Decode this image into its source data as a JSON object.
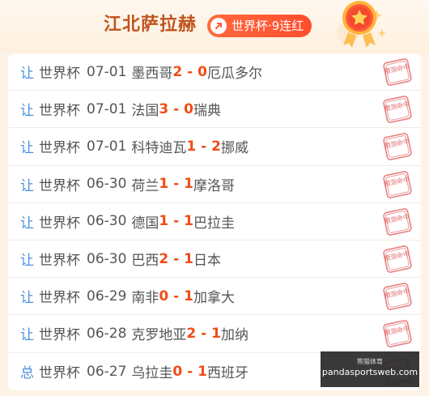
{
  "header": {
    "expert_name": "江北萨拉赫",
    "streak_label": "世界杯·9连红",
    "badge_color": "#ff5a35",
    "medal_icon": "star-medal-icon"
  },
  "stamp_text": "预测命中",
  "results": [
    {
      "type": "让",
      "league": "世界杯",
      "date": "07-01",
      "home": "墨西哥",
      "home_score": "2",
      "sep": " - ",
      "away_score": "0",
      "away": "厄瓜多尔"
    },
    {
      "type": "让",
      "league": "世界杯",
      "date": "07-01",
      "home": "法国",
      "home_score": "3",
      "sep": " - ",
      "away_score": "0",
      "away": "瑞典"
    },
    {
      "type": "让",
      "league": "世界杯",
      "date": "07-01",
      "home": "科特迪瓦",
      "home_score": "1",
      "sep": " - ",
      "away_score": "2",
      "away": "挪威"
    },
    {
      "type": "让",
      "league": "世界杯",
      "date": "06-30",
      "home": "荷兰",
      "home_score": "1",
      "sep": " - ",
      "away_score": "1",
      "away": "摩洛哥"
    },
    {
      "type": "让",
      "league": "世界杯",
      "date": "06-30",
      "home": "德国",
      "home_score": "1",
      "sep": " - ",
      "away_score": "1",
      "away": "巴拉圭"
    },
    {
      "type": "让",
      "league": "世界杯",
      "date": "06-30",
      "home": "巴西",
      "home_score": "2",
      "sep": " - ",
      "away_score": "1",
      "away": "日本"
    },
    {
      "type": "让",
      "league": "世界杯",
      "date": "06-29",
      "home": "南非",
      "home_score": "0",
      "sep": " - ",
      "away_score": "1",
      "away": "加拿大"
    },
    {
      "type": "让",
      "league": "世界杯",
      "date": "06-28",
      "home": "克罗地亚",
      "home_score": "2",
      "sep": " - ",
      "away_score": "1",
      "away": "加纳"
    },
    {
      "type": "总",
      "league": "世界杯",
      "date": "06-27",
      "home": "乌拉圭",
      "home_score": "0",
      "sep": " - ",
      "away_score": "1",
      "away": "西班牙"
    }
  ],
  "watermark": {
    "top": "熊猫体育",
    "bottom": "pandasportsweb.com"
  },
  "colors": {
    "type_label": "#4a8fe0",
    "score": "#f04c16",
    "stamp": "#e06a6a",
    "title": "#c0531f"
  }
}
